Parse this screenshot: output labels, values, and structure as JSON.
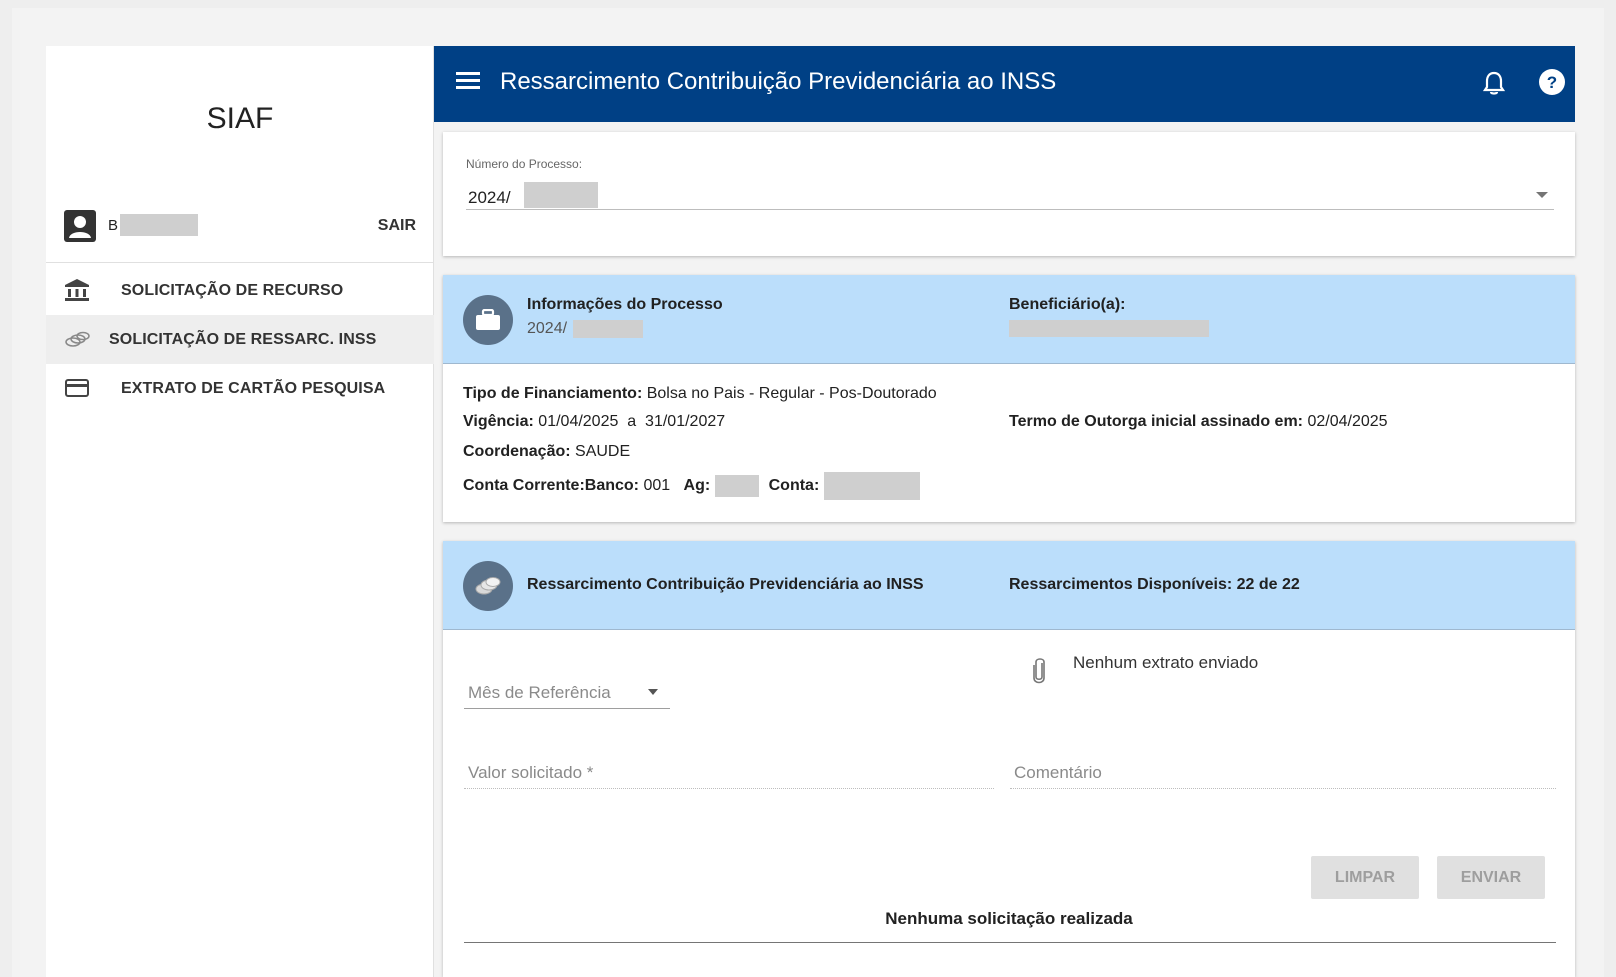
{
  "sidebar": {
    "title": "SIAF",
    "user": {
      "name": "B",
      "logout_label": "SAIR"
    },
    "items": [
      {
        "label": "SOLICITAÇÃO DE RECURSO",
        "icon": "bank-icon"
      },
      {
        "label": "SOLICITAÇÃO DE RESSARC. INSS",
        "icon": "coins-icon"
      },
      {
        "label": "EXTRATO DE CARTÃO PESQUISA",
        "icon": "credit-card-icon"
      }
    ]
  },
  "header": {
    "title": "Ressarcimento Contribuição Previdenciária ao INSS"
  },
  "process": {
    "label": "Número do Processo:",
    "value": "2024/"
  },
  "info": {
    "title": "Informações do Processo",
    "process_number": "2024/",
    "beneficiary_label": "Beneficiário(a):",
    "tipo_label": "Tipo de Financiamento:",
    "tipo_value": "Bolsa no Pais - Regular - Pos-Doutorado",
    "vigencia_label": "Vigência:",
    "vigencia_value": "01/04/2025  a  31/01/2027",
    "termo_label": "Termo de Outorga inicial assinado em:",
    "termo_value": "02/04/2025",
    "coordenacao_label": "Coordenação:",
    "coordenacao_value": "SAUDE",
    "conta_label": "Conta Corrente:",
    "banco_label": "Banco:",
    "banco_value": "001",
    "ag_label": "Ag:",
    "conta_num_label": "Conta:"
  },
  "ressarcimento": {
    "title": "Ressarcimento Contribuição Previdenciária ao INSS",
    "available": "Ressarcimentos Disponíveis: 22 de 22",
    "mes_label": "Mês de Referência",
    "extrato_status": "Nenhum extrato enviado",
    "valor_label": "Valor solicitado *",
    "comentario_label": "Comentário",
    "limpar_label": "LIMPAR",
    "enviar_label": "ENVIAR",
    "empty_message": "Nenhuma solicitação realizada"
  },
  "colors": {
    "appbar": "#004085",
    "section_header": "#bbdefb",
    "icon_circle": "#5a7189"
  }
}
